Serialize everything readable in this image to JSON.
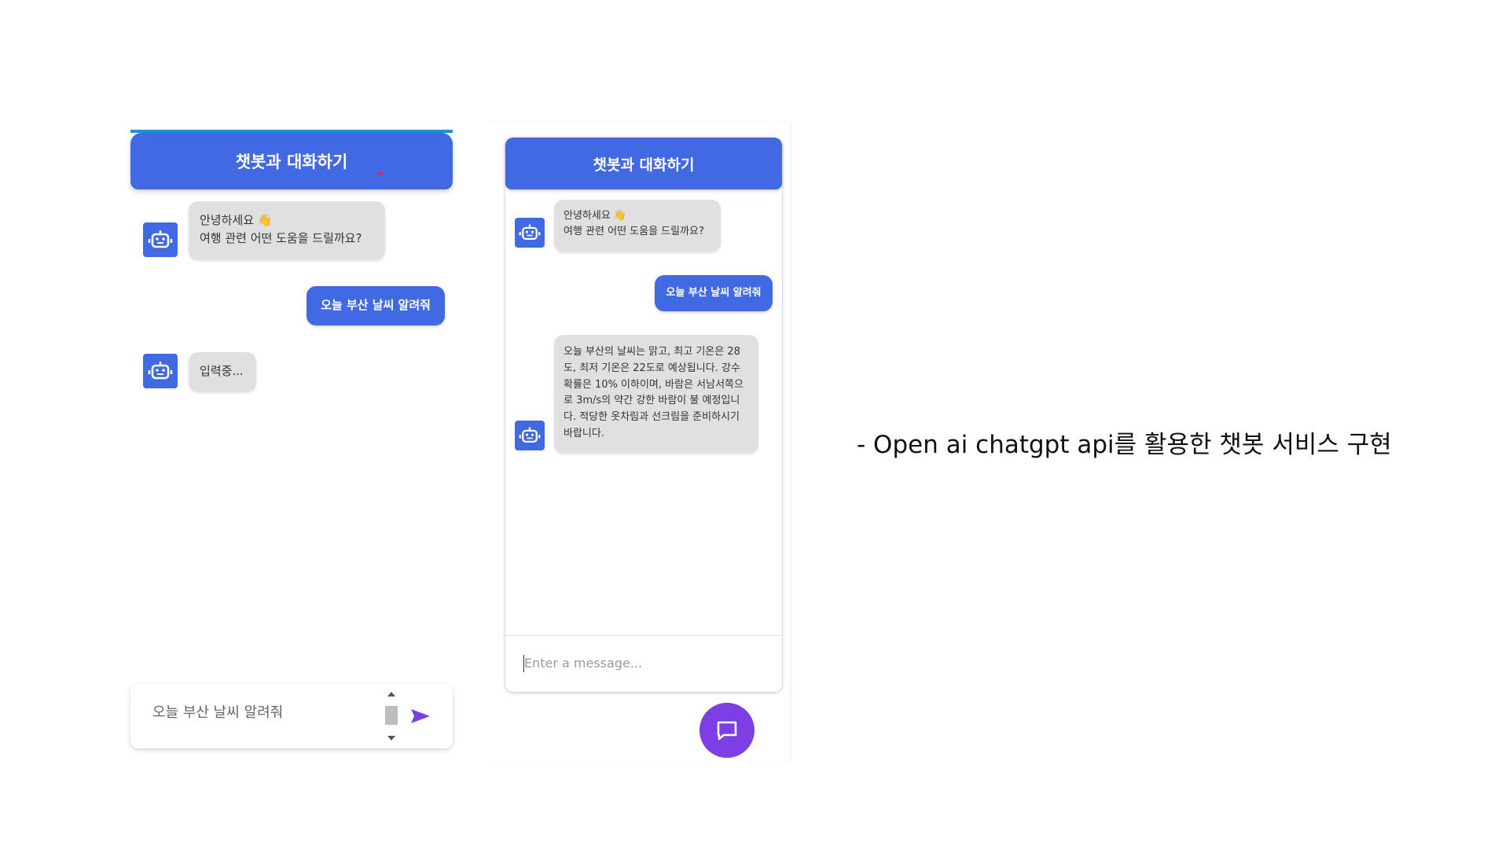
{
  "left_chat": {
    "header_title": "챗봇과 대화하기",
    "messages": [
      {
        "role": "bot",
        "text": "안녕하세요 👋\n여행 관련 어떤 도움을 드릴까요?"
      },
      {
        "role": "user",
        "text": "오늘 부산 날씨 알려줘"
      },
      {
        "role": "bot",
        "text": "입력중..."
      }
    ],
    "input_value": "오늘 부산 날씨 알려줘",
    "send_icon": "send-arrow-icon"
  },
  "right_chat": {
    "header_title": "챗봇과 대화하기",
    "messages": [
      {
        "role": "bot",
        "text": "안녕하세요 👋\n여행 관련 어떤 도움을 드릴까요?"
      },
      {
        "role": "user",
        "text": "오늘 부산 날씨 알려줘"
      },
      {
        "role": "bot",
        "text": "오늘 부산의 날씨는 맑고, 최고 기온은 28도, 최저 기온은 22도로 예상됩니다. 강수 확률은 10% 이하이며, 바람은 서남서쪽으로 3m/s의 약간 강한 바람이 불 예정입니다. 적당한 옷차림과 선크림을 준비하시기 바랍니다."
      }
    ],
    "input_placeholder": "Enter a message...",
    "fab_icon": "chat-bubble-icon"
  },
  "caption": "- Open ai chatgpt api를 활용한 챗봇 서비스 구현",
  "colors": {
    "header_blue": "#4169e1",
    "bot_bubble": "#e0e0e0",
    "fab_purple": "#7b3fe4",
    "send_purple": "#7b3fe4"
  }
}
